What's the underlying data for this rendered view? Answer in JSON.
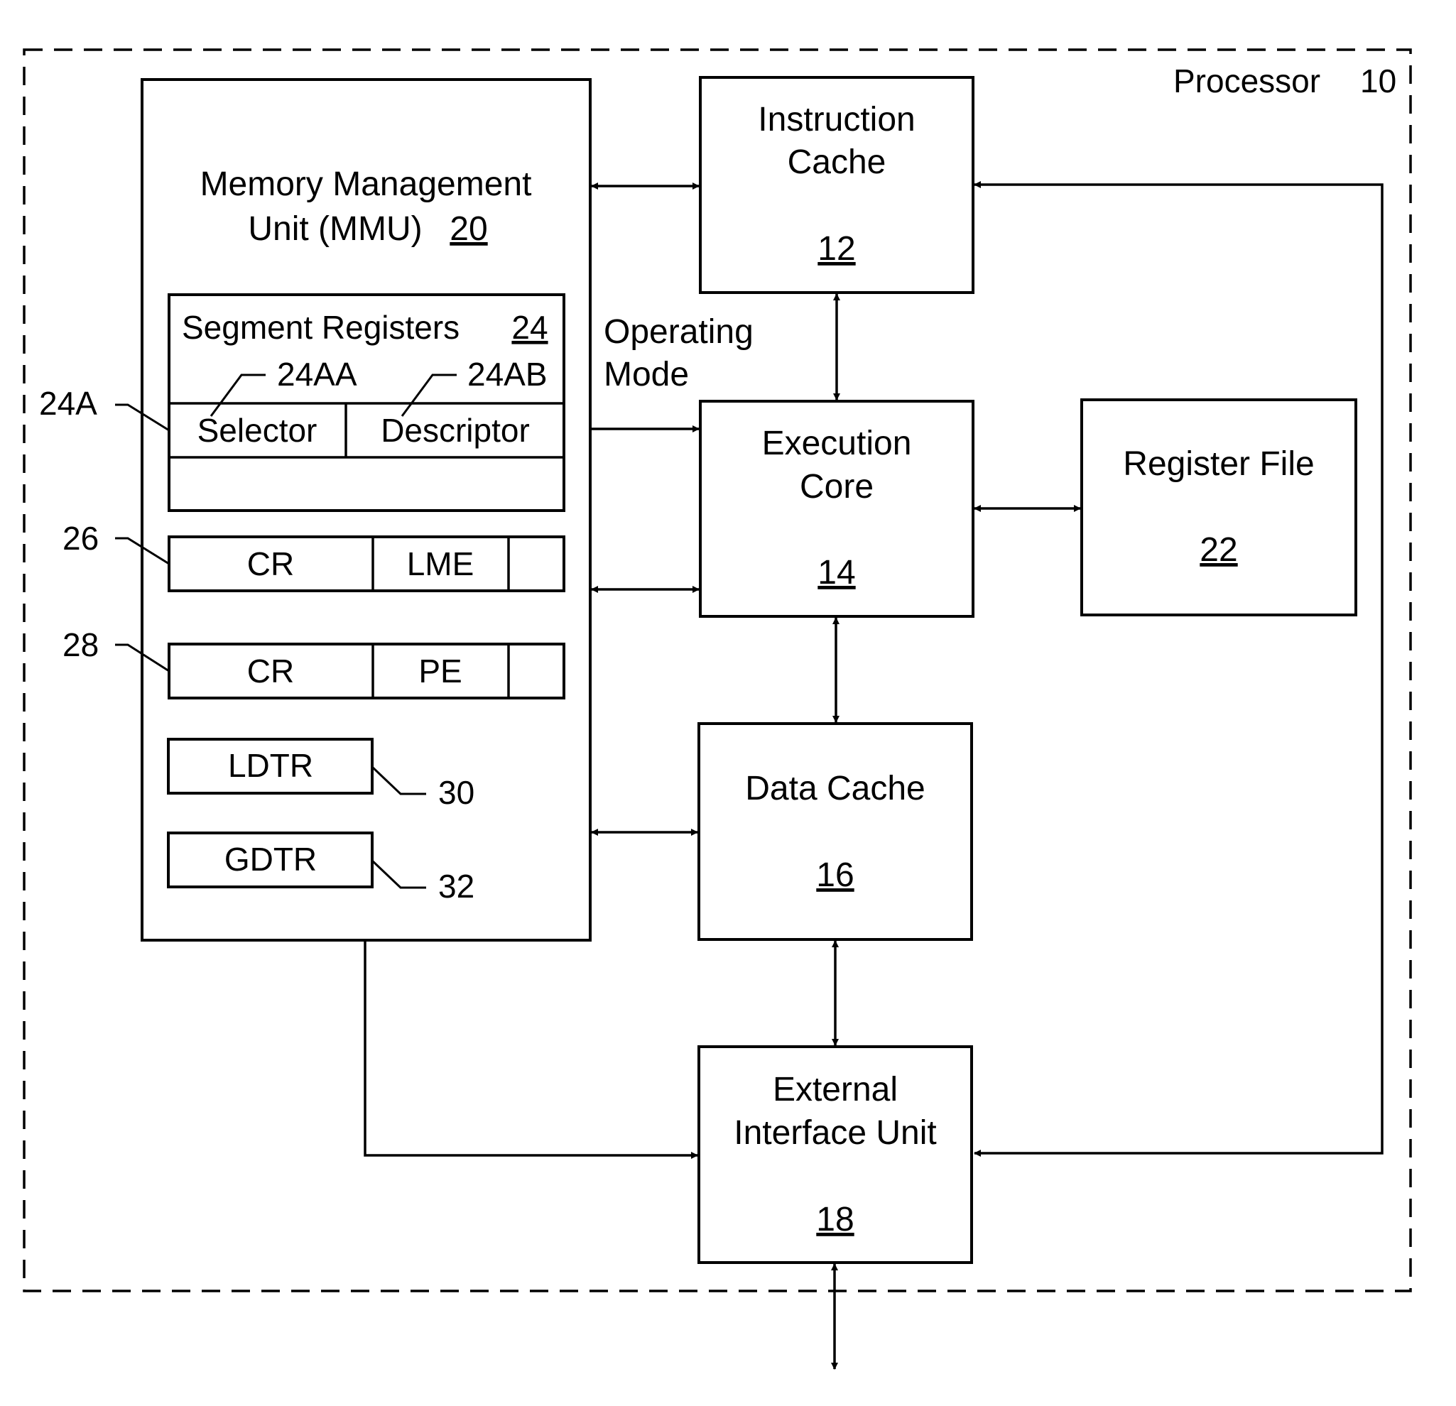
{
  "figure": {
    "container": {
      "label": "Processor",
      "ref": "10"
    },
    "blocks": {
      "mmu": {
        "line1": "Memory Management",
        "line2": "Unit (MMU)",
        "ref": "20"
      },
      "icache": {
        "line1": "Instruction",
        "line2": "Cache",
        "ref": "12"
      },
      "exec": {
        "line1": "Execution",
        "line2": "Core",
        "ref": "14"
      },
      "regfile": {
        "line1": "Register File",
        "ref": "22"
      },
      "dcache": {
        "line1": "Data Cache",
        "ref": "16"
      },
      "eiu": {
        "line1": "External",
        "line2": "Interface Unit",
        "ref": "18"
      }
    },
    "segment_registers": {
      "title": "Segment Registers",
      "ref": "24",
      "entry_ref": "24A",
      "selector": {
        "label": "Selector",
        "ref": "24AA"
      },
      "descriptor": {
        "label": "Descriptor",
        "ref": "24AB"
      }
    },
    "control_registers": [
      {
        "ref": "26",
        "name": "CR",
        "field": "LME"
      },
      {
        "ref": "28",
        "name": "CR",
        "field": "PE"
      }
    ],
    "table_registers": [
      {
        "name": "LDTR",
        "ref": "30"
      },
      {
        "name": "GDTR",
        "ref": "32"
      }
    ],
    "signals": {
      "operating_mode_line1": "Operating",
      "operating_mode_line2": "Mode"
    }
  }
}
